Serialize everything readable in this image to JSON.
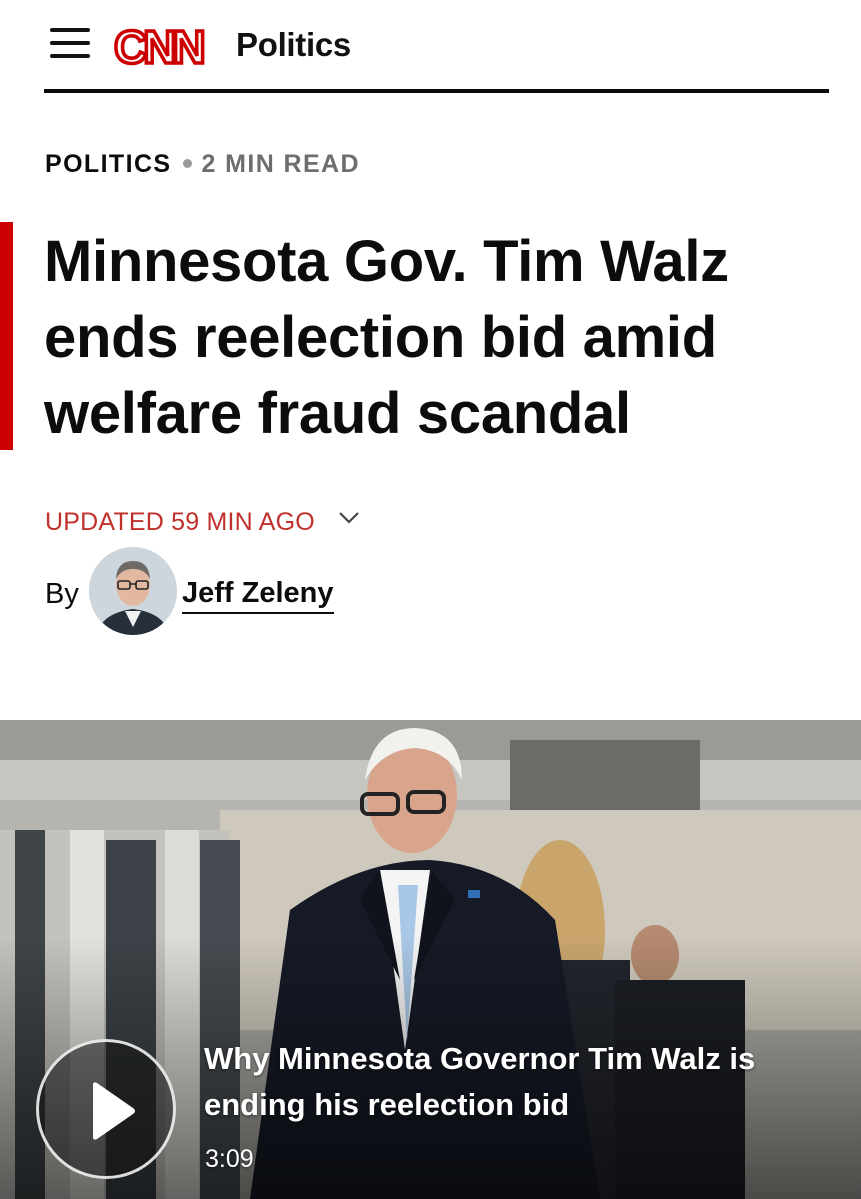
{
  "header": {
    "logo_text": "CNN",
    "section_link": "Politics",
    "menu_icon": "hamburger-menu-icon"
  },
  "article": {
    "kicker_section": "POLITICS",
    "kicker_read_time": "2 MIN READ",
    "headline": "Minnesota Gov. Tim Walz ends reelection bid amid welfare fraud scandal",
    "updated": "UPDATED 59 MIN AGO",
    "byline_prefix": "By",
    "author": "Jeff Zeleny"
  },
  "video": {
    "title": "Why Minnesota Governor Tim Walz is ending his reelection bid",
    "duration": "3:09",
    "play_icon": "play-icon"
  },
  "colors": {
    "brand_red": "#cc0000",
    "updated_red": "#c0312b",
    "text": "#0c0c0c"
  }
}
